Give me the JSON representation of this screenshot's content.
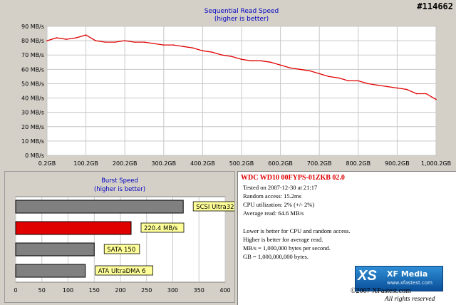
{
  "corner_id": "#114662",
  "chart_data": [
    {
      "type": "line",
      "title": "Sequential Read Speed",
      "subtitle": "(higher is better)",
      "x_tick_labels": [
        "0.2GB",
        "100.2GB",
        "200.2GB",
        "300.2GB",
        "400.2GB",
        "500.2GB",
        "600.2GB",
        "700.2GB",
        "800.2GB",
        "900.2GB",
        "1,000.2GB"
      ],
      "y_tick_labels": [
        "0 MB/s",
        "10 MB/s",
        "20 MB/s",
        "30 MB/s",
        "40 MB/s",
        "50 MB/s",
        "60 MB/s",
        "70 MB/s",
        "80 MB/s",
        "90 MB/s"
      ],
      "xlim": [
        0.2,
        1000.2
      ],
      "ylim": [
        0,
        90
      ],
      "grid": true,
      "series": [
        {
          "color": "#e00000",
          "x": [
            0.2,
            25,
            50,
            75,
            100,
            125,
            150,
            175,
            200,
            225,
            250,
            275,
            300,
            325,
            350,
            375,
            400,
            425,
            450,
            475,
            500,
            525,
            550,
            575,
            600,
            625,
            650,
            675,
            700,
            725,
            750,
            775,
            800,
            825,
            850,
            875,
            900,
            925,
            950,
            975,
            1000.2
          ],
          "y": [
            80,
            82,
            81,
            82,
            84,
            80,
            79,
            79,
            80,
            79,
            79,
            78,
            77,
            77,
            76,
            75,
            73,
            72,
            70,
            69,
            67,
            66,
            66,
            65,
            63,
            61,
            60,
            59,
            57,
            55,
            54,
            52,
            52,
            50,
            49,
            48,
            47,
            46,
            43,
            43,
            39
          ]
        }
      ]
    },
    {
      "type": "bar",
      "orientation": "horizontal",
      "title": "Burst Speed",
      "subtitle": "(higher is better)",
      "categories": [
        "SCSI Ultra320",
        "220.4 MB/s",
        "SATA 150",
        "ATA UltraDMA 6"
      ],
      "values": [
        320,
        220.4,
        150,
        133
      ],
      "colors": [
        "#808080",
        "#e00000",
        "#808080",
        "#808080"
      ],
      "x_tick_labels": [
        "0",
        "50",
        "100",
        "150",
        "200",
        "250",
        "300",
        "350",
        "400"
      ],
      "xlim": [
        0,
        400
      ],
      "grid": true
    }
  ],
  "info": {
    "title": "WDC  WD10  00FYPS-01ZKB 02.0",
    "lines": [
      "Tested on 2007-12-30 at 21:17",
      "Random access: 15.2ms",
      "CPU utilization: 2% (+/- 2%)",
      "Average read: 64.6 MB/s"
    ],
    "notes": [
      "Lower is better for CPU and random access.",
      "Higher is better for average read.",
      "MB/s = 1,000,000 bytes per second.",
      "GB = 1,000,000,000 bytes."
    ],
    "logo_mark": "XS",
    "logo_name": "XF Media",
    "logo_url": "www.xfastest.com",
    "copyright": "©2007 XFastest.com",
    "rights": "All rights reserved"
  }
}
